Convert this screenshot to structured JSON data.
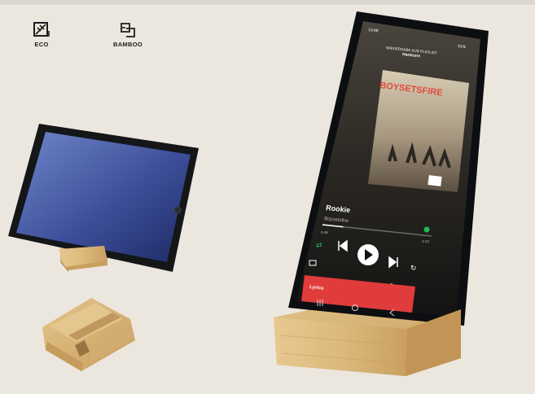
{
  "badges": [
    {
      "label": "ECO",
      "icon": "eco-leaf-square-icon"
    },
    {
      "label": "BAMBOO",
      "icon": "bamboo-square-icon"
    }
  ],
  "phone_screen": {
    "status_time": "13:48",
    "status_battery": "61%",
    "header_line1": "WIEDERGABE AUS PLAYLIST",
    "header_line2": "Hardcore",
    "album_band": "BOYSETSFIRE",
    "track_title": "Rookie",
    "track_artist": "Boysetsfire",
    "time_elapsed": "0:48",
    "time_total": "4:13",
    "lyrics_label": "Lyrics",
    "progress": 0.19
  },
  "colors": {
    "background": "#ece7de",
    "bamboo": "#d8b67a",
    "bamboo_dark": "#b98f52",
    "spotify_green": "#1db954",
    "lyrics_red": "#e03c3c"
  }
}
